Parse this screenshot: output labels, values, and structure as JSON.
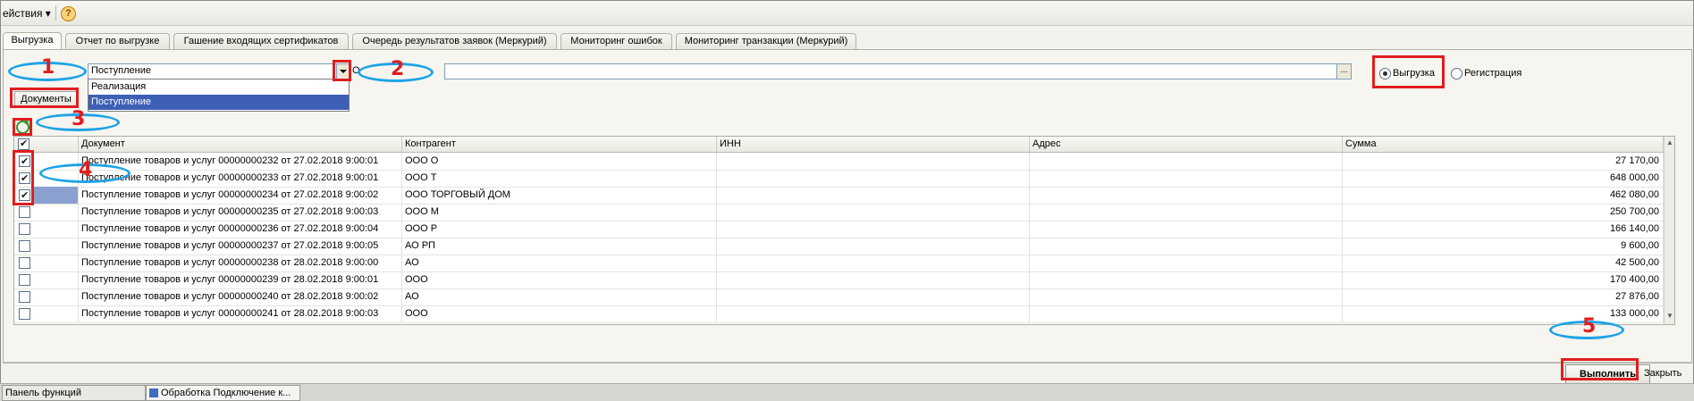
{
  "toolbar": {
    "actions_label": "ействия ▾",
    "help_icon": "?"
  },
  "tabs": [
    {
      "label": "Выгрузка",
      "active": true
    },
    {
      "label": "Отчет по выгрузке"
    },
    {
      "label": "Гашение входящих сертификатов"
    },
    {
      "label": "Очередь результатов заявок (Меркурий)"
    },
    {
      "label": "Мониторинг ошибок"
    },
    {
      "label": "Мониторинг транзакции (Меркурий)"
    }
  ],
  "form": {
    "operation_value": "Поступление",
    "operation_options": [
      "Реализация",
      "Поступление"
    ],
    "label_o": "О",
    "field2_value": "",
    "field2_btn": "...",
    "mode_options": [
      "Выгрузка",
      "Регистрация"
    ],
    "mode_selected": "Выгрузка",
    "documents_button": "Документы"
  },
  "grid": {
    "columns": [
      "Документ",
      "Контрагент",
      "ИНН",
      "Адрес",
      "Сумма"
    ],
    "rows": [
      {
        "checked": true,
        "doc": "Поступление товаров и услуг 00000000232 от 27.02.2018 9:00:01",
        "contragent": "ООО   О",
        "inn": "",
        "address": "",
        "sum": "27 170,00"
      },
      {
        "checked": true,
        "doc": "Поступление товаров и услуг 00000000233 от 27.02.2018 9:00:01",
        "contragent": "ООО   Т",
        "inn": "",
        "address": "",
        "sum": "648 000,00"
      },
      {
        "checked": true,
        "doc": "Поступление товаров и услуг 00000000234 от 27.02.2018 9:00:02",
        "contragent": "ООО   ТОРГОВЫЙ ДОМ",
        "inn": "",
        "address": "",
        "sum": "462 080,00"
      },
      {
        "checked": false,
        "doc": "Поступление товаров и услуг 00000000235 от 27.02.2018 9:00:03",
        "contragent": "ООО   М",
        "inn": "",
        "address": "",
        "sum": "250 700,00"
      },
      {
        "checked": false,
        "doc": "Поступление товаров и услуг 00000000236 от 27.02.2018 9:00:04",
        "contragent": "ООО    Р",
        "inn": "",
        "address": "",
        "sum": "166 140,00"
      },
      {
        "checked": false,
        "doc": "Поступление товаров и услуг 00000000237 от 27.02.2018 9:00:05",
        "contragent": "АО   РП",
        "inn": "",
        "address": "",
        "sum": "9 600,00"
      },
      {
        "checked": false,
        "doc": "Поступление товаров и услуг 00000000238 от 28.02.2018 9:00:00",
        "contragent": "АО",
        "inn": "",
        "address": "",
        "sum": "42 500,00"
      },
      {
        "checked": false,
        "doc": "Поступление товаров и услуг 00000000239 от 28.02.2018 9:00:01",
        "contragent": "ООО",
        "inn": "",
        "address": "",
        "sum": "170 400,00"
      },
      {
        "checked": false,
        "doc": "Поступление товаров и услуг 00000000240 от 28.02.2018 9:00:02",
        "contragent": "АО",
        "inn": "",
        "address": "",
        "sum": "27 876,00"
      },
      {
        "checked": false,
        "doc": "Поступление товаров и услуг 00000000241 от 28.02.2018 9:00:03",
        "contragent": "ООО",
        "inn": "",
        "address": "",
        "sum": "133 000,00"
      }
    ]
  },
  "footer": {
    "run_button": "Выполнить",
    "close_label": "Закрыть"
  },
  "taskbar": [
    {
      "label": "Панель функций"
    },
    {
      "label": "Обработка  Подключение к..."
    }
  ],
  "annotations": [
    "1",
    "2",
    "3",
    "4",
    "5"
  ],
  "colors": {
    "marker_red": "#e01e1e",
    "marker_blue": "#1da3e6",
    "selection_blue": "#3d5fb5"
  }
}
